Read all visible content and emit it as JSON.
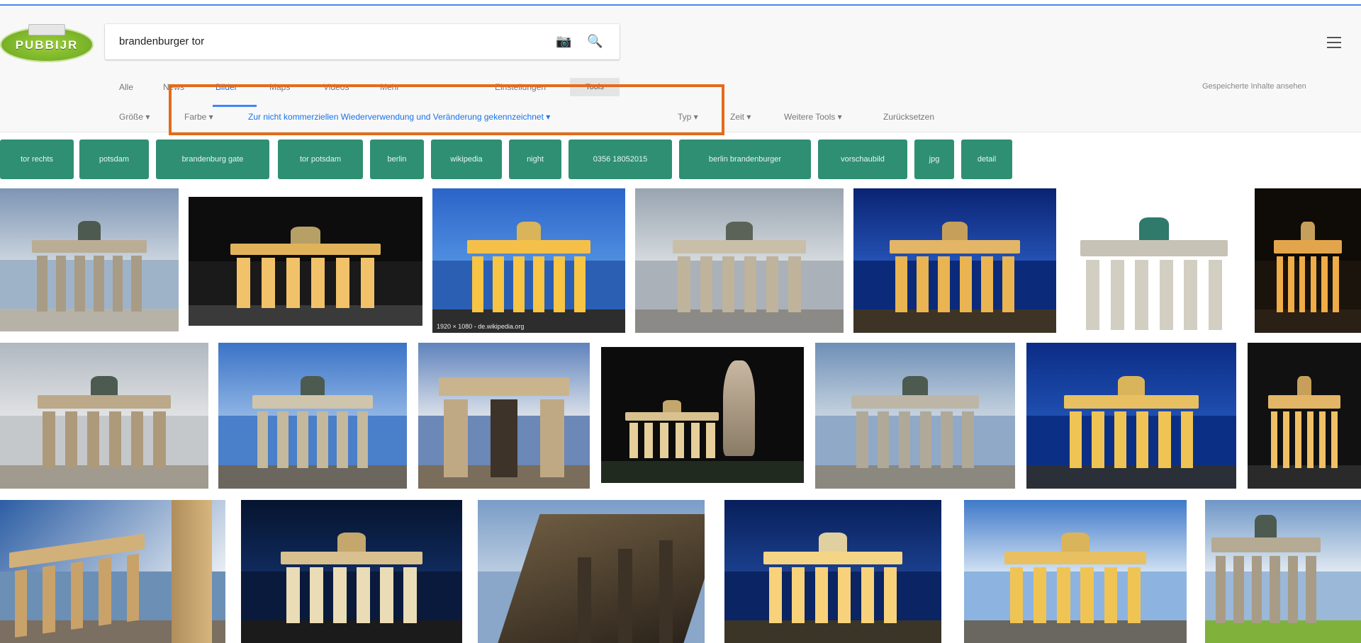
{
  "search": {
    "query": "brandenburger tor",
    "camera_icon": "camera-icon",
    "search_icon": "search-icon"
  },
  "logo": {
    "text": "PUBBIJR"
  },
  "tabs": {
    "items": [
      "Alle",
      "News",
      "Bilder",
      "Maps",
      "Videos",
      "Mehr"
    ],
    "active": "Bilder",
    "settings": "Einstellungen",
    "tools": "Tools"
  },
  "saved": "Gespeicherte Inhalte ansehen",
  "filters": {
    "size": "Größe ▾",
    "color": "Farbe ▾",
    "usage": "Zur nicht kommerziellen Wiederverwendung und Veränderung gekennzeichnet ▾",
    "type": "Typ ▾",
    "time": "Zeit ▾",
    "more": "Weitere Tools ▾",
    "reset": "Zurücksetzen"
  },
  "chips": [
    "tor rechts",
    "potsdam",
    "brandenburg gate",
    "tor potsdam",
    "berlin",
    "wikipedia",
    "night",
    "0356 18052015",
    "berlin brandenburger",
    "vorschaubild",
    "jpg",
    "detail"
  ],
  "images": {
    "caption_1": "1920 × 1080 - de.wikipedia.org"
  },
  "colors": {
    "chip_bg": "#2f8f73",
    "accent": "#4285f4",
    "highlight_box": "#e36b1b"
  }
}
